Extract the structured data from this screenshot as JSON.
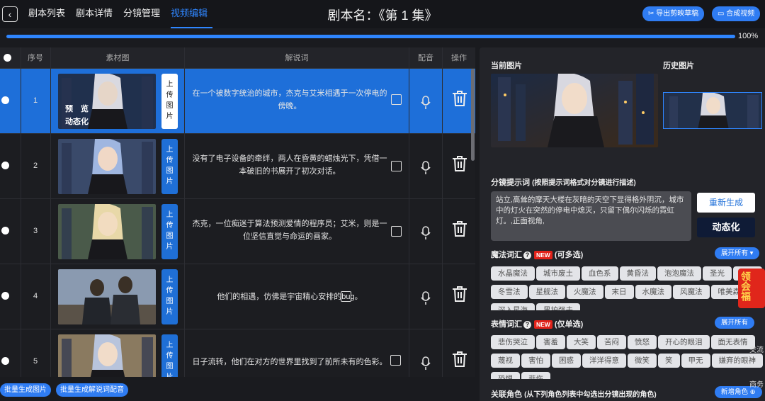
{
  "nav": {
    "back_icon": "chevron-left-icon",
    "tabs": [
      "剧本列表",
      "剧本详情",
      "分镜管理",
      "视频编辑"
    ],
    "active_tab": 3
  },
  "header": {
    "title": "剧本名：《第 1 集》",
    "export_label": "导出剪映草稿",
    "compose_label": "合成视频"
  },
  "progress": {
    "value": 100,
    "label": "100%"
  },
  "table": {
    "headers": {
      "index": "序号",
      "material": "素材图",
      "caption": "解说词",
      "audio": "配音",
      "action": "操作"
    },
    "upload_label": [
      "上",
      "传",
      "图",
      "片"
    ],
    "preview_label": "预　览",
    "animate_label": "动态化",
    "rows": [
      {
        "index": "1",
        "caption": "在一个被数字统治的城市，杰克与艾米相遇于一次停电的傍晚。",
        "selected": true
      },
      {
        "index": "2",
        "caption": "没有了电子设备的牵绊，两人在昏黄的蜡烛光下，凭借一本破旧的书展开了初次对话。",
        "selected": false
      },
      {
        "index": "3",
        "caption": "杰克，一位痴迷于算法预测爱情的程序员；艾米，则是一位坚信直觉与命运的画家。",
        "selected": false
      },
      {
        "index": "4",
        "caption": "他们的相遇，仿佛是宇宙精心安排的bug。",
        "selected": false
      },
      {
        "index": "5",
        "caption": "日子流转，他们在对方的世界里找到了前所未有的色彩。",
        "selected": false
      }
    ],
    "batch_image_label": "批量生成图片",
    "batch_audio_label": "批量生成解说词配音"
  },
  "panel": {
    "current_image_label": "当前图片",
    "history_image_label": "历史图片",
    "prompt_title": "分镜提示词",
    "prompt_hint": "(按照提示词格式对分镜进行描述)",
    "prompt_text": "站立,高耸的摩天大楼在灰暗的天空下显得格外阴沉，城市中的灯火在突然的停电中熄灭，只留下偶尔闪烁的霓虹灯。,正面视角,",
    "regen_label": "重新生成",
    "animate_label": "动态化",
    "magic": {
      "title": "魔法词汇",
      "new_badge": "NEW",
      "hint": "(可多选)",
      "expand": "展开所有",
      "chips": [
        "水晶魔法",
        "城市废土",
        "血色系",
        "黄昏法",
        "泡泡魔法",
        "圣光",
        "明风",
        "冬雪法",
        "星舰法",
        "火魔法",
        "末日",
        "水魔法",
        "风魔法",
        "唯美森晚",
        "深入星海",
        "黑护强夫"
      ]
    },
    "emotion": {
      "title": "表情词汇",
      "new_badge": "NEW",
      "hint": "(仅单选)",
      "expand": "展开所有",
      "chips": [
        "悲伤哭泣",
        "害羞",
        "大笑",
        "苦闷",
        "愤怒",
        "开心的眼泪",
        "面无表情",
        "蔑视",
        "害怕",
        "困惑",
        "洋洋得意",
        "微笑",
        "笑",
        "甲无",
        "嫌弃的眼神",
        "恐惧",
        "悲伤"
      ]
    },
    "roles": {
      "title": "关联角色",
      "hint": "(从下列角色列表中勾选出分镜出现的角色)",
      "add_label": "新增角色"
    },
    "side": {
      "gift_text": "领会福",
      "chat_label": "交流",
      "biz_label": "商务"
    }
  }
}
